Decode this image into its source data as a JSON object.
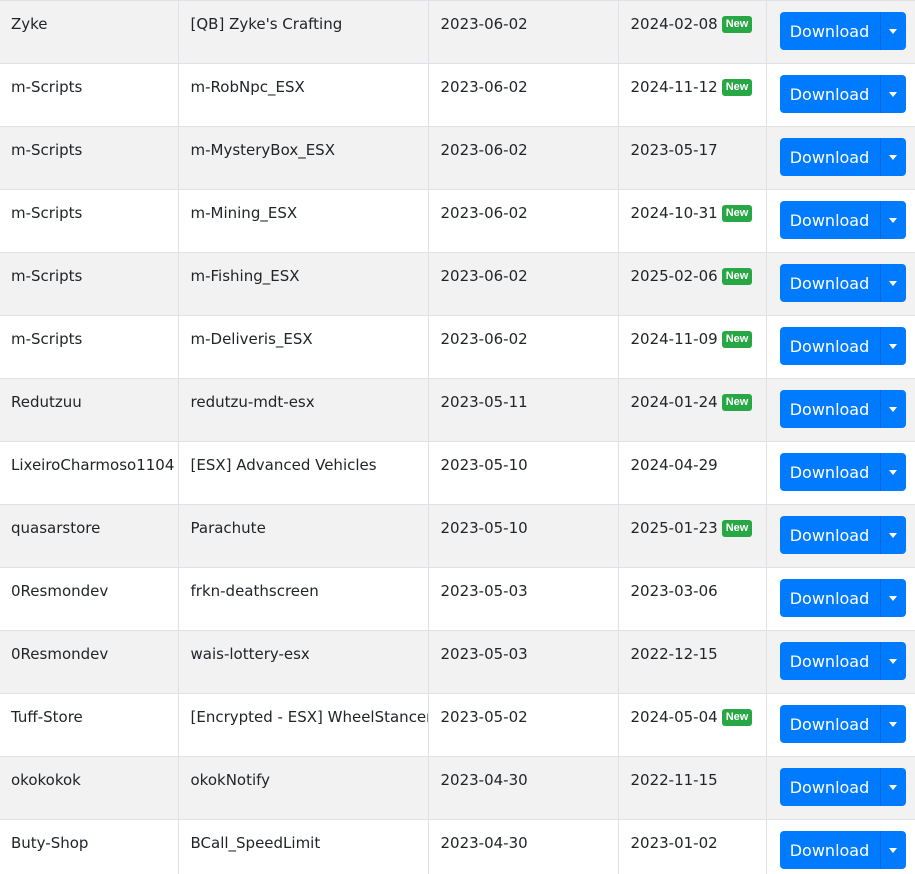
{
  "button_label": "Download",
  "badge_label": "New",
  "rows": [
    {
      "author": "Zyke",
      "name": "[QB] Zyke's Crafting",
      "added": "2023-06-02",
      "updated": "2024-02-08",
      "new": true
    },
    {
      "author": "m-Scripts",
      "name": "m-RobNpc_ESX",
      "added": "2023-06-02",
      "updated": "2024-11-12",
      "new": true
    },
    {
      "author": "m-Scripts",
      "name": "m-MysteryBox_ESX",
      "added": "2023-06-02",
      "updated": "2023-05-17",
      "new": false
    },
    {
      "author": "m-Scripts",
      "name": "m-Mining_ESX",
      "added": "2023-06-02",
      "updated": "2024-10-31",
      "new": true
    },
    {
      "author": "m-Scripts",
      "name": "m-Fishing_ESX",
      "added": "2023-06-02",
      "updated": "2025-02-06",
      "new": true
    },
    {
      "author": "m-Scripts",
      "name": "m-Deliveris_ESX",
      "added": "2023-06-02",
      "updated": "2024-11-09",
      "new": true
    },
    {
      "author": "Redutzuu",
      "name": "redutzu-mdt-esx",
      "added": "2023-05-11",
      "updated": "2024-01-24",
      "new": true
    },
    {
      "author": "LixeiroCharmoso1104",
      "name": "[ESX] Advanced Vehicles",
      "added": "2023-05-10",
      "updated": "2024-04-29",
      "new": false
    },
    {
      "author": "quasarstore",
      "name": "Parachute",
      "added": "2023-05-10",
      "updated": "2025-01-23",
      "new": true
    },
    {
      "author": "0Resmondev",
      "name": "frkn-deathscreen",
      "added": "2023-05-03",
      "updated": "2023-03-06",
      "new": false
    },
    {
      "author": "0Resmondev",
      "name": "wais-lottery-esx",
      "added": "2023-05-03",
      "updated": "2022-12-15",
      "new": false
    },
    {
      "author": "Tuff-Store",
      "name": "[Encrypted - ESX] WheelStancer",
      "added": "2023-05-02",
      "updated": "2024-05-04",
      "new": true
    },
    {
      "author": "okokokok",
      "name": "okokNotify",
      "added": "2023-04-30",
      "updated": "2022-11-15",
      "new": false
    },
    {
      "author": "Buty-Shop",
      "name": "BCall_SpeedLimit",
      "added": "2023-04-30",
      "updated": "2023-01-02",
      "new": false
    }
  ]
}
